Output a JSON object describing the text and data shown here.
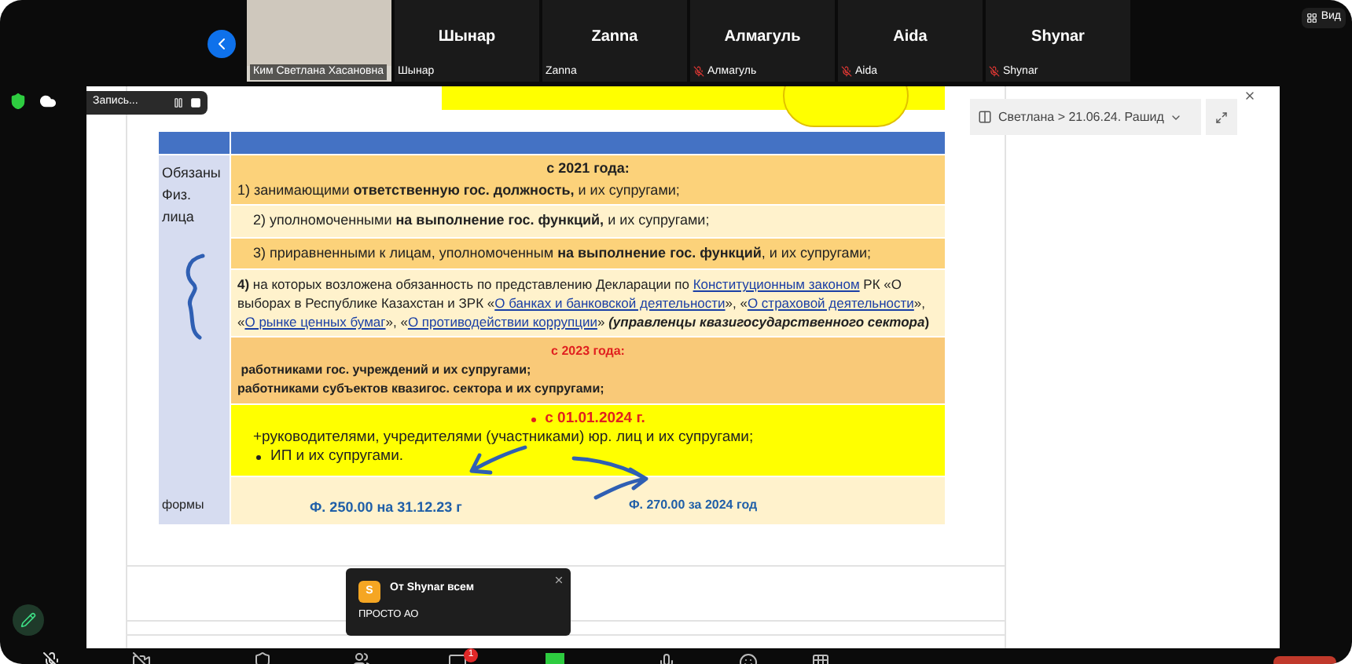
{
  "gallery": {
    "tiles": [
      {
        "kind": "video",
        "label": "Ким Светлана Хасановна",
        "muted": false
      },
      {
        "kind": "name",
        "name": "Шынар",
        "label": "Шынар",
        "muted": false
      },
      {
        "kind": "name",
        "name": "Zanna",
        "label": "Zanna",
        "muted": false
      },
      {
        "kind": "name",
        "name": "Алмагуль",
        "label": "Алмагуль",
        "muted": true
      },
      {
        "kind": "name",
        "name": "Aida",
        "label": "Aida",
        "muted": true
      },
      {
        "kind": "name",
        "name": "Shynar",
        "label": "Shynar",
        "muted": true
      }
    ],
    "view_button": "Вид"
  },
  "recording": {
    "label": "Запись..."
  },
  "viewer": {
    "breadcrumb": "Светлана > 21.06.24. Рашид"
  },
  "slide": {
    "side_label": "Обязаны Физ. лица",
    "forms_label": "формы",
    "rows": [
      {
        "kind": "header",
        "color": "#fcd27a",
        "title": "с 2021 года:",
        "lines": [
          "1) занимающими **ответственную гос. должность,** и их супругами;"
        ]
      },
      {
        "kind": "indent",
        "color": "#fff2cc",
        "lines": [
          "2) уполномоченными **на выполнение гос. функций,** и их супругами;"
        ]
      },
      {
        "kind": "indent",
        "color": "#fcd27a",
        "lines": [
          "3) приравненными к лицам, уполномоченным **на выполнение гос. функций**, и их супругами;"
        ]
      },
      {
        "kind": "rich",
        "color": "#fff2cc",
        "segments": [
          {
            "kind": "bold",
            "text": "4)"
          },
          {
            "kind": "plain",
            "text": " на которых возложена обязанность по представлению Декларации по "
          },
          {
            "kind": "link",
            "text": "Конституционным законом"
          },
          {
            "kind": "plain",
            "text": " РК «О выборах в Республике Казахстан и ЗРК «"
          },
          {
            "kind": "link",
            "text": "О банках и банковской деятельности"
          },
          {
            "kind": "plain",
            "text": "», «"
          },
          {
            "kind": "link",
            "text": "О страховой деятельности"
          },
          {
            "kind": "plain",
            "text": "», «"
          },
          {
            "kind": "link",
            "text": "О рынке ценных бумаг"
          },
          {
            "kind": "plain",
            "text": "», «"
          },
          {
            "kind": "link",
            "text": "О противодействии коррупции"
          },
          {
            "kind": "plain",
            "text": "» "
          },
          {
            "kind": "bolditalic",
            "text": "(управленцы квазигосударственного сектора"
          },
          {
            "kind": "bold",
            "text": ")"
          }
        ]
      },
      {
        "kind": "boldlines",
        "color": "#f9c978",
        "title": "с 2023 года:",
        "lines": [
          " работниками гос. учреждений и их супругами;",
          "работниками субъектов квазигос. сектора и их супругами;"
        ]
      },
      {
        "kind": "bullets",
        "color": "#ffff00",
        "title": "с 01.01.2024 г.",
        "lines": [
          "+руководителями, учредителями (участниками) юр. лиц и их супругами;",
          "ИП и их супругами."
        ]
      }
    ],
    "forms": [
      "Ф. 250.00 на 31.12.23 г",
      "Ф. 270.00 за 2024 год"
    ]
  },
  "chat": {
    "avatar": "S",
    "from": "От Shynar всем",
    "message": "ПРОСТО АО",
    "badge": "1"
  }
}
